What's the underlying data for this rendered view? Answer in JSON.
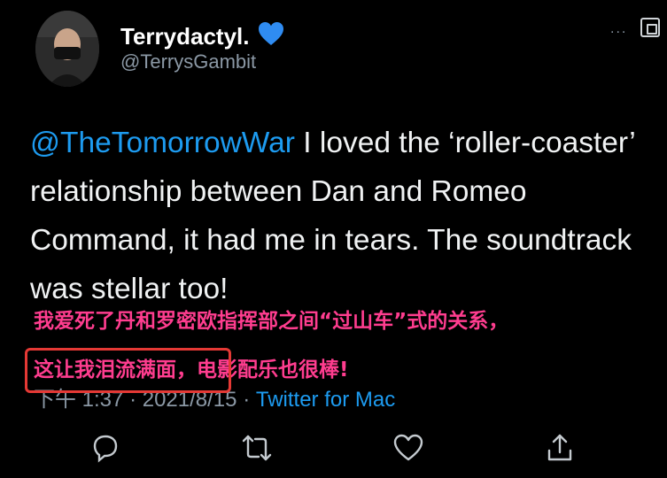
{
  "author": {
    "display_name": "Terrydactyl.",
    "verified_emoji": "💙",
    "handle": "@TerrysGambit"
  },
  "tweet": {
    "mention": "@TheTomorrowWar",
    "text": " I loved the ‘roller-coaster’ relationship between Dan and Romeo Command, it had me in tears. The soundtrack was stellar too!"
  },
  "annotation": {
    "line1": "我爱死了丹和罗密欧指挥部之间“过山车”式的关系，",
    "line2_boxed": "这让我泪流满面，",
    "line2_rest": "电影配乐也很棒!"
  },
  "meta": {
    "time": "下午 1:37",
    "separator": "·",
    "date": "2021/8/15",
    "source": "Twitter for Mac"
  },
  "header": {
    "more_label": "..."
  },
  "colors": {
    "background": "#000000",
    "mention": "#1d9bf0",
    "annotation": "#ff3d8f",
    "highlight_box": "#e53935"
  },
  "icons": {
    "reply": "reply-icon",
    "retweet": "retweet-icon",
    "like": "heart-icon",
    "share": "share-icon",
    "expand": "expand-icon"
  }
}
